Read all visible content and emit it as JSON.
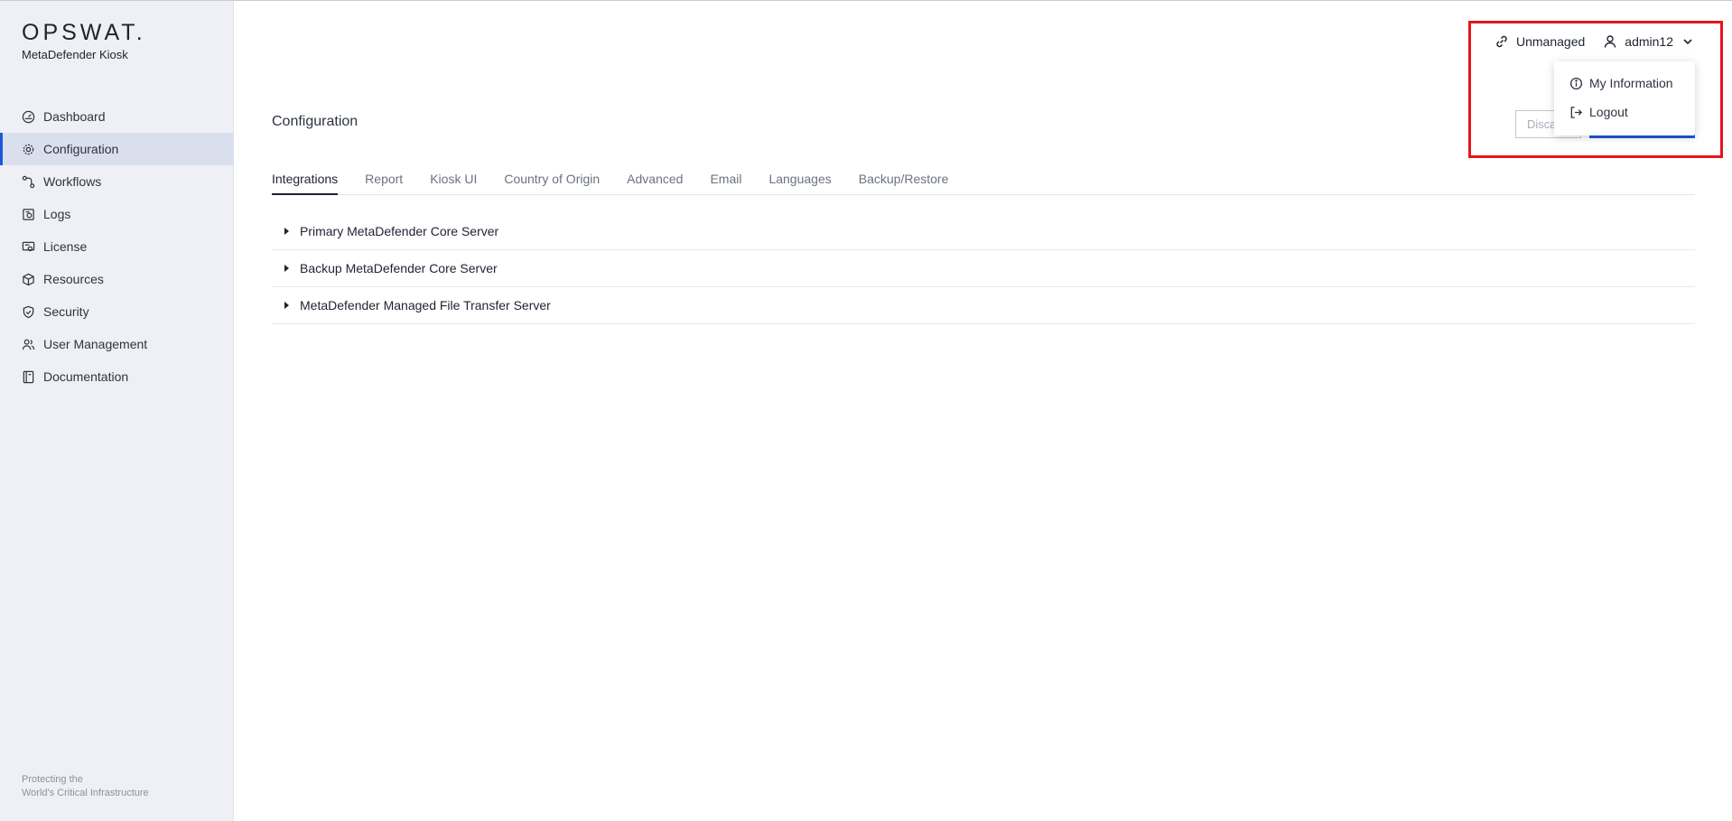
{
  "brand": {
    "logo": "OPSWAT.",
    "product": "MetaDefender Kiosk"
  },
  "sidebar": {
    "items": [
      {
        "label": "Dashboard",
        "icon": "dashboard-icon"
      },
      {
        "label": "Configuration",
        "icon": "gear-icon"
      },
      {
        "label": "Workflows",
        "icon": "workflow-icon"
      },
      {
        "label": "Logs",
        "icon": "logs-icon"
      },
      {
        "label": "License",
        "icon": "license-icon"
      },
      {
        "label": "Resources",
        "icon": "cube-icon"
      },
      {
        "label": "Security",
        "icon": "shield-icon"
      },
      {
        "label": "User Management",
        "icon": "users-icon"
      },
      {
        "label": "Documentation",
        "icon": "book-icon"
      }
    ],
    "active_index": 1,
    "tagline_line1": "Protecting the",
    "tagline_line2": "World's Critical Infrastructure"
  },
  "header": {
    "unmanaged_label": "Unmanaged",
    "username": "admin12"
  },
  "user_menu": {
    "my_information": "My Information",
    "logout": "Logout"
  },
  "main": {
    "title": "Configuration",
    "discard_label": "Disca",
    "tabs": [
      "Integrations",
      "Report",
      "Kiosk UI",
      "Country of Origin",
      "Advanced",
      "Email",
      "Languages",
      "Backup/Restore"
    ],
    "active_tab": 0,
    "sections": [
      "Primary MetaDefender Core Server",
      "Backup MetaDefender Core Server",
      "MetaDefender Managed File Transfer Server"
    ]
  },
  "colors": {
    "accent": "#1d58d8",
    "highlight": "#e8141c",
    "sidebar_bg": "#eff0f5"
  }
}
